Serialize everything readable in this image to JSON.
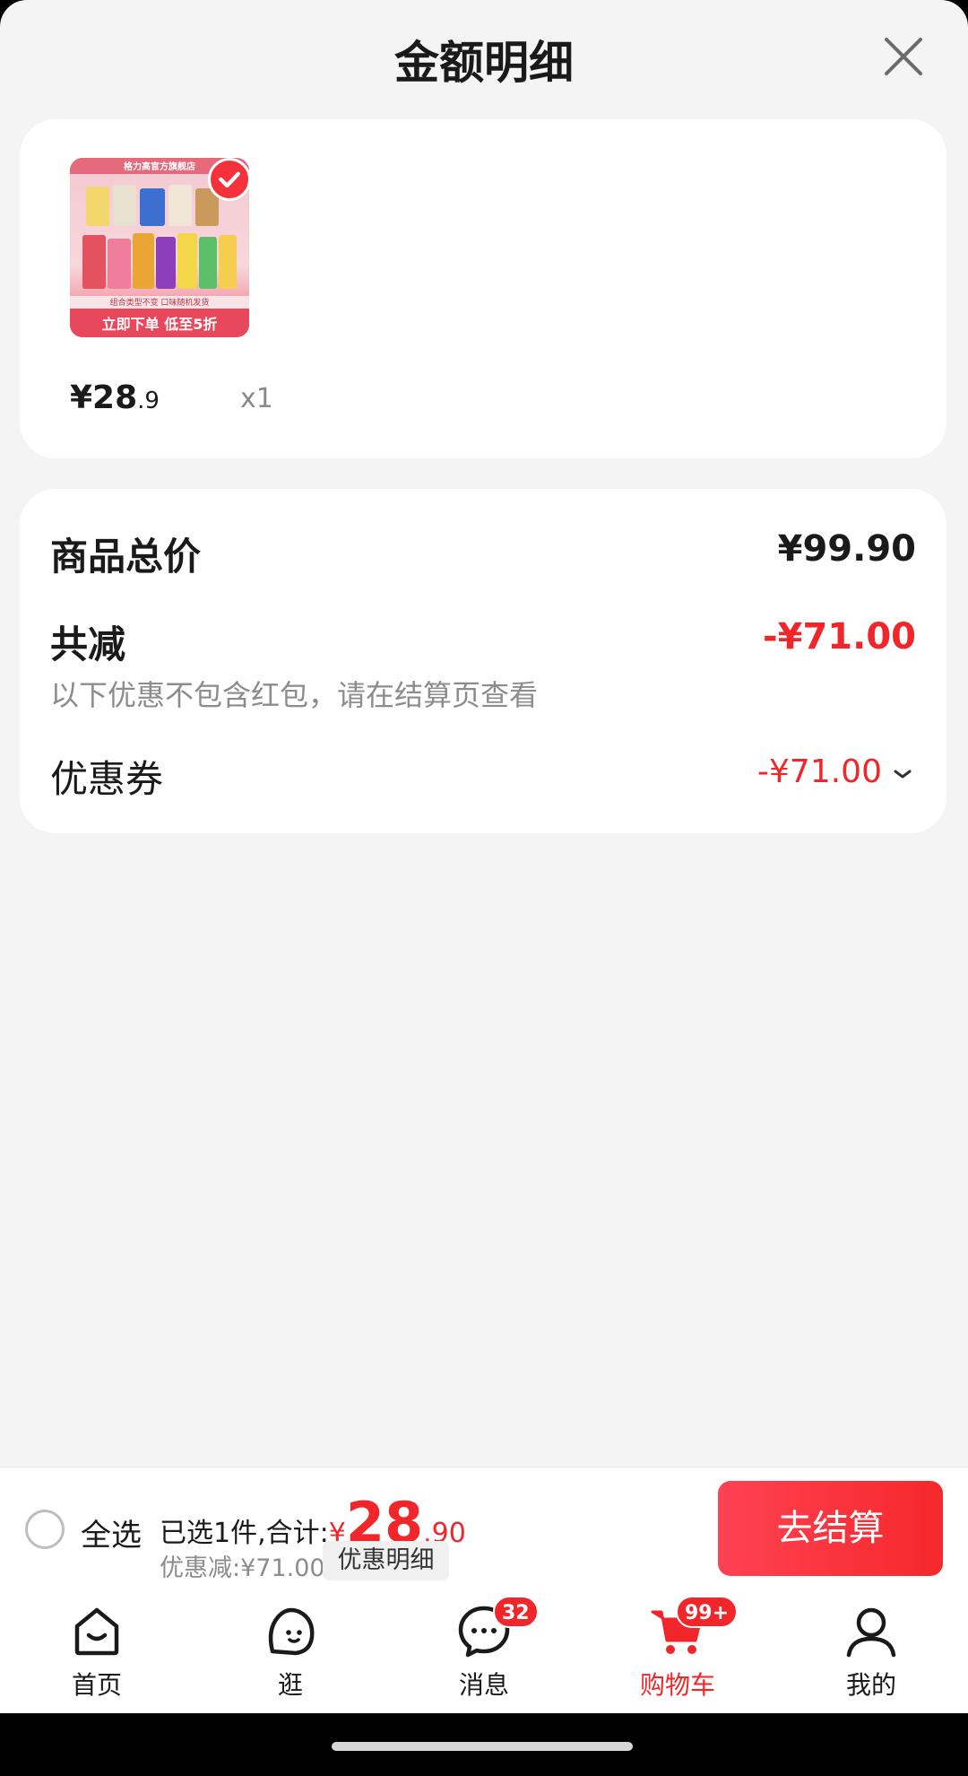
{
  "sheet": {
    "title": "金额明细"
  },
  "product": {
    "image": {
      "brand_text": "格力高官方旗舰店",
      "sub_text": "组合类型不变 口味随机发货",
      "banner_text": "立即下单 低至5折"
    },
    "price_main": "¥28",
    "price_decimal": ".9",
    "quantity": "x1",
    "selected": true
  },
  "summary": {
    "total_label": "商品总价",
    "total_value": "¥99.90",
    "reduction_label": "共减",
    "reduction_value": "-¥71.00",
    "note": "以下优惠不包含红包，请在结算页查看",
    "coupon_label": "优惠券",
    "coupon_value": "-¥71.00"
  },
  "checkout_bar": {
    "select_all_label": "全选",
    "selected_summary": "已选1件,合计:",
    "currency_symbol": "¥",
    "amount_integer": "28",
    "amount_decimal": ".90",
    "discount_text": "优惠减:¥71.00",
    "detail_button": "优惠明细",
    "checkout_button": "去结算"
  },
  "tabbar": {
    "items": [
      {
        "label": "首页",
        "icon": "home-icon"
      },
      {
        "label": "逛",
        "icon": "explore-icon"
      },
      {
        "label": "消息",
        "icon": "message-icon",
        "badge": "32"
      },
      {
        "label": "购物车",
        "icon": "cart-icon",
        "badge": "99+",
        "active": true
      },
      {
        "label": "我的",
        "icon": "profile-icon"
      }
    ]
  },
  "colors": {
    "accent": "#f0262a",
    "background": "#f4f4f4",
    "card": "#ffffff",
    "muted_text": "#8c8c8c"
  }
}
